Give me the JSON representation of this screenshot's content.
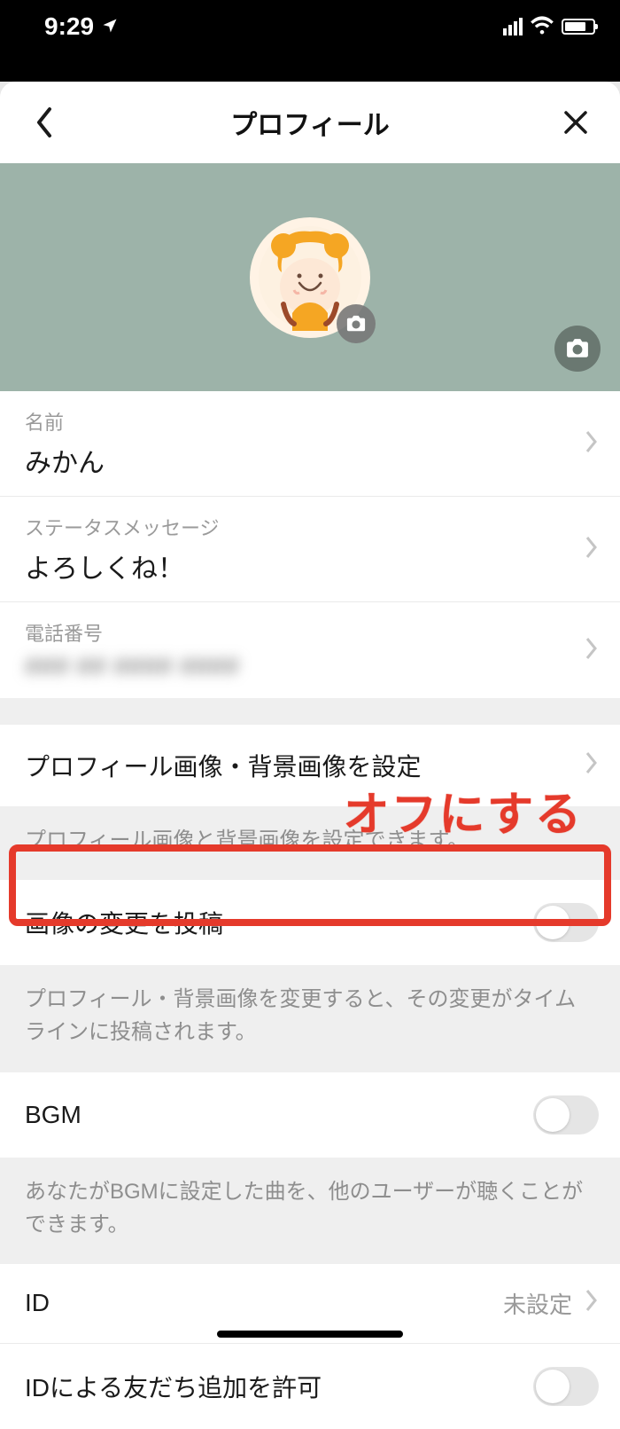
{
  "status": {
    "time": "9:29",
    "location_icon": "location-arrow"
  },
  "header": {
    "title": "プロフィール"
  },
  "cover": {
    "avatar_camera_icon": "camera-icon",
    "cover_camera_icon": "camera-icon"
  },
  "profile": {
    "name_label": "名前",
    "name_value": "みかん",
    "status_label": "ステータスメッセージ",
    "status_value": "よろしくね！",
    "phone_label": "電話番号",
    "phone_value": "### ## #### ####"
  },
  "rows": {
    "set_images": "プロフィール画像・背景画像を設定",
    "set_images_hint": "プロフィール画像と背景画像を設定できます。",
    "post_image_change": "画像の変更を投稿",
    "post_image_change_hint": "プロフィール・背景画像を変更すると、その変更がタイムラインに投稿されます。",
    "bgm": "BGM",
    "bgm_hint": "あなたがBGMに設定した曲を、他のユーザーが聴くことができます。",
    "id": "ID",
    "id_value": "未設定",
    "id_allow": "IDによる友だち追加を許可"
  },
  "toggles": {
    "post_image_change": false,
    "bgm": false,
    "id_allow": false
  },
  "annotation": {
    "text": "オフにする"
  }
}
